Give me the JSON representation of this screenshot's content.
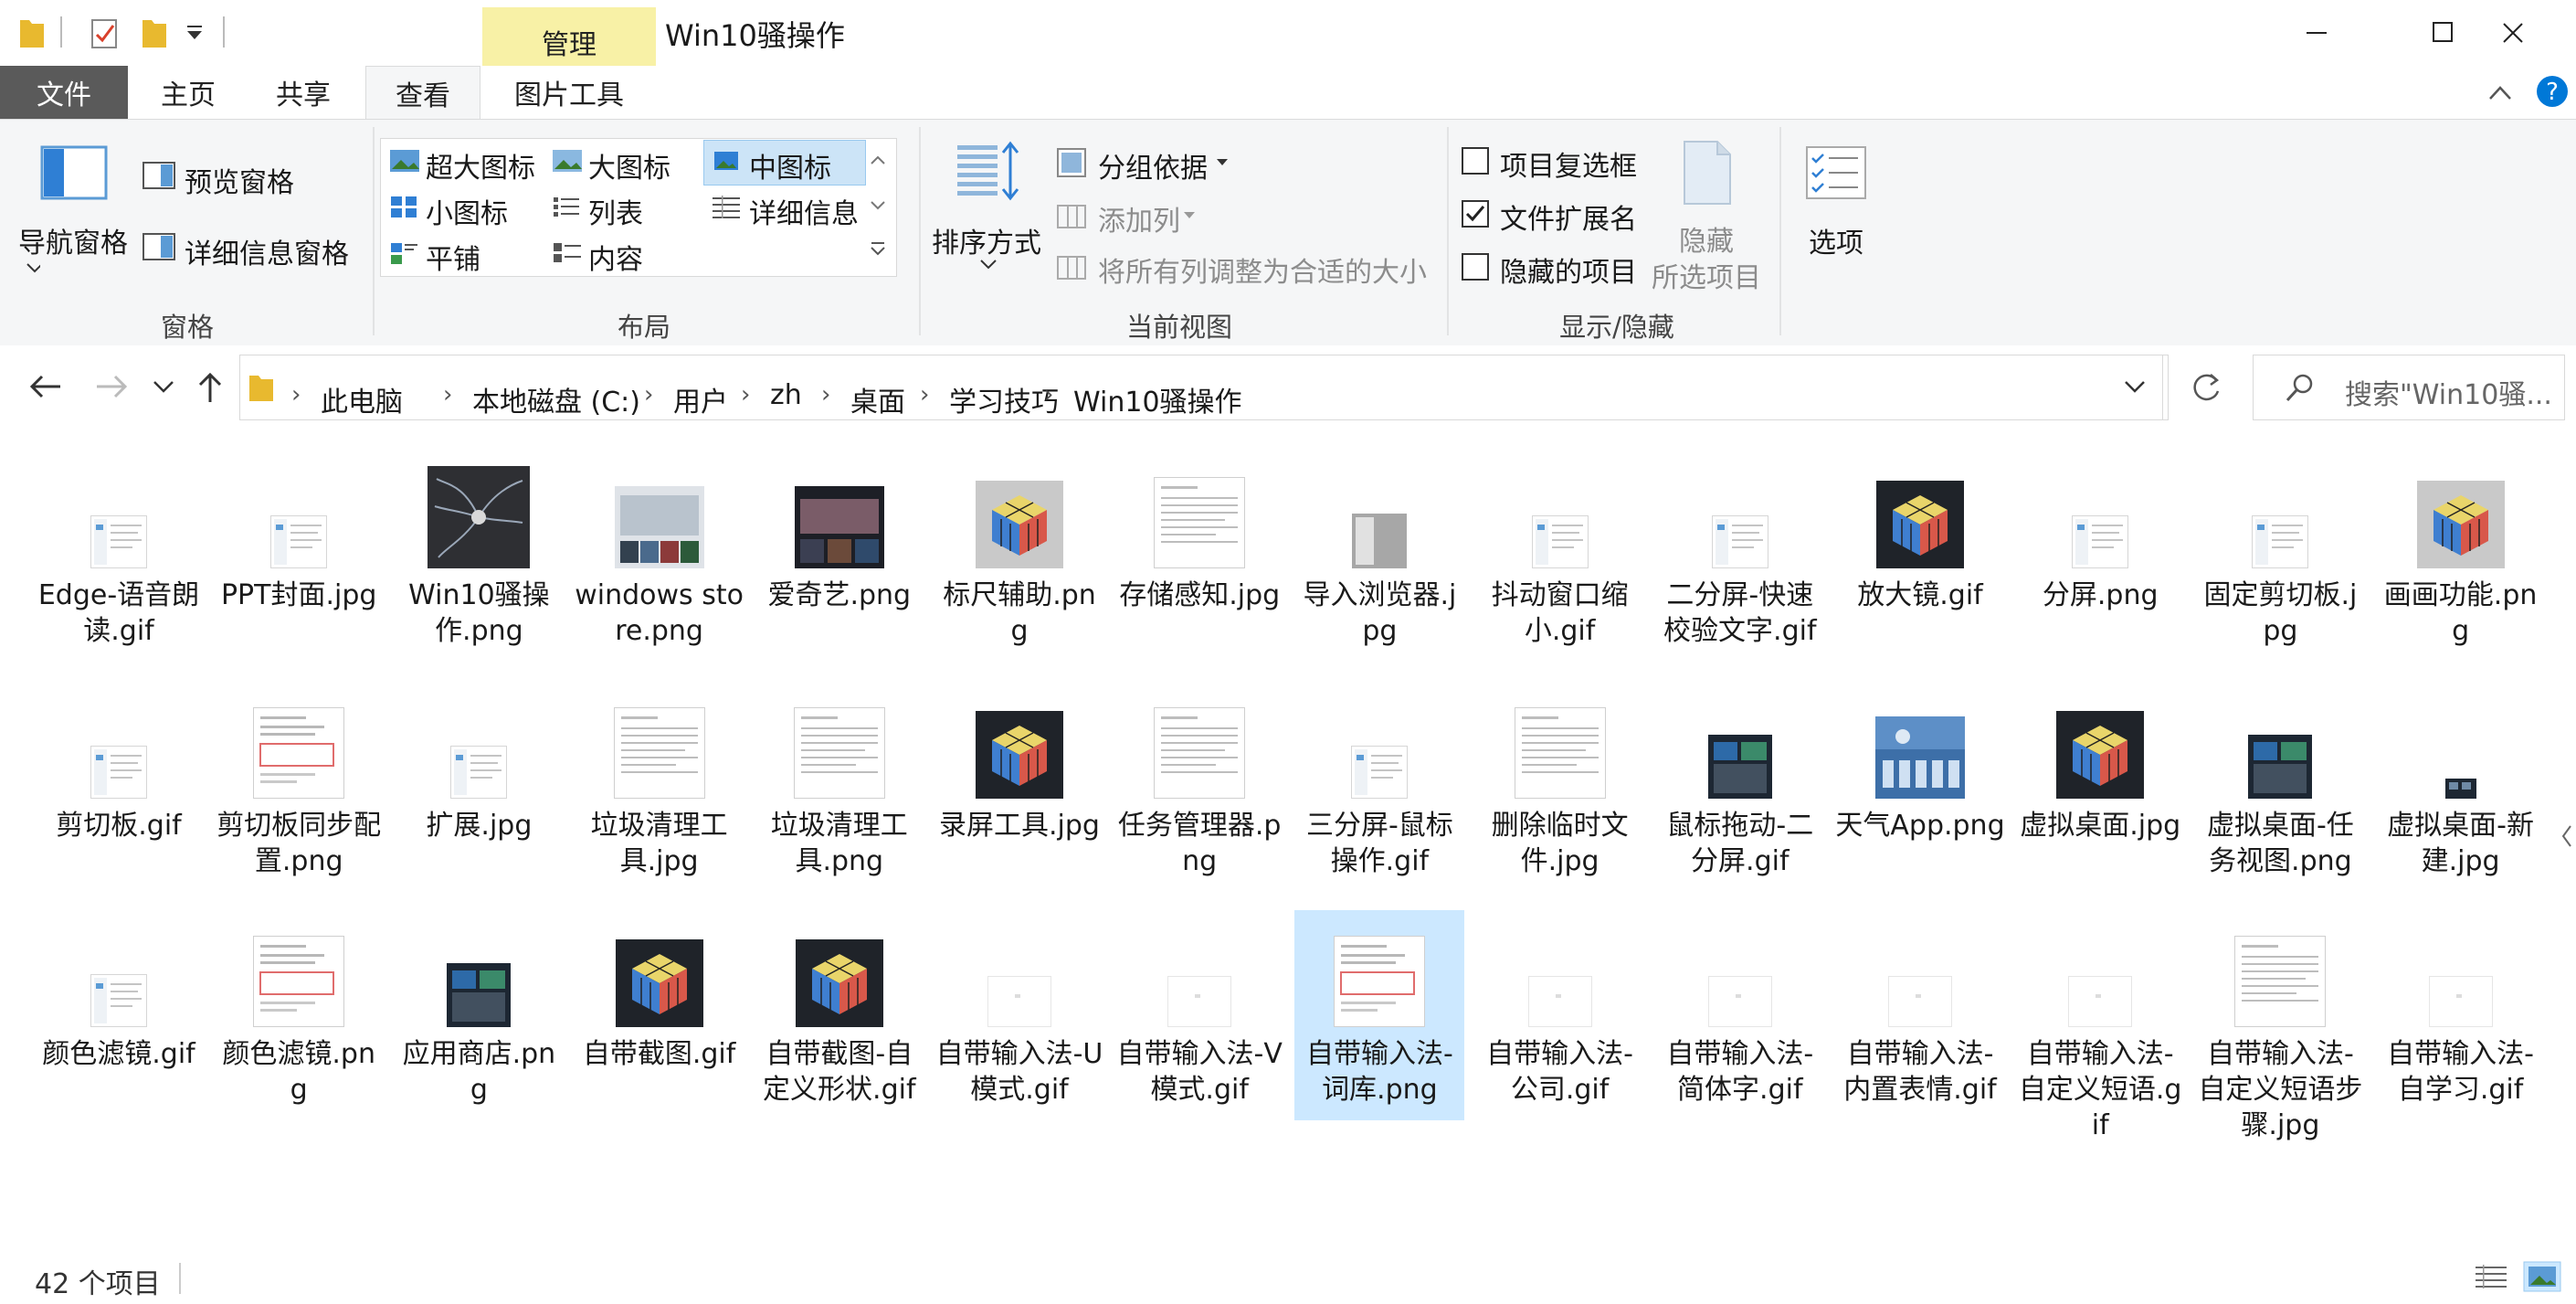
{
  "window": {
    "title": "Win10骚操作",
    "context_tab": "管理"
  },
  "ribbon_tabs": [
    "文件",
    "主页",
    "共享",
    "查看",
    "图片工具"
  ],
  "ribbon": {
    "panes": {
      "nav_pane": "导航窗格",
      "preview_pane": "预览窗格",
      "details_pane": "详细信息窗格",
      "group": "窗格"
    },
    "layout": {
      "options": [
        "超大图标",
        "大图标",
        "中图标",
        "小图标",
        "列表",
        "详细信息",
        "平铺",
        "内容"
      ],
      "selected": "中图标",
      "group": "布局"
    },
    "current_view": {
      "sort_by": "排序方式",
      "group_by": "分组依据",
      "add_columns": "添加列",
      "fit_columns": "将所有列调整为合适的大小",
      "group": "当前视图"
    },
    "show_hide": {
      "item_checkboxes": "项目复选框",
      "file_extensions": "文件扩展名",
      "hidden_items": "隐藏的项目",
      "hide_selected_line1": "隐藏",
      "hide_selected_line2": "所选项目",
      "group": "显示/隐藏",
      "checked": {
        "item_checkboxes": false,
        "file_extensions": true,
        "hidden_items": false
      }
    },
    "options": "选项"
  },
  "address": {
    "breadcrumbs": [
      "此电脑",
      "本地磁盘 (C:)",
      "用户",
      "zh",
      "桌面",
      "学习技巧",
      "Win10骚操作"
    ],
    "search_placeholder": "搜索\"Win10骚..."
  },
  "files": [
    {
      "name": "Edge-语音朗读.gif",
      "thumb": "doc-small"
    },
    {
      "name": "PPT封面.jpg",
      "thumb": "doc-small"
    },
    {
      "name": "Win10骚操作.png",
      "thumb": "mindmap"
    },
    {
      "name": "windows store.png",
      "thumb": "store"
    },
    {
      "name": "爱奇艺.png",
      "thumb": "video"
    },
    {
      "name": "标尺辅助.png",
      "thumb": "cube-gray"
    },
    {
      "name": "存储感知.jpg",
      "thumb": "doc"
    },
    {
      "name": "导入浏览器.jpg",
      "thumb": "gray"
    },
    {
      "name": "抖动窗口缩小.gif",
      "thumb": "doc-small"
    },
    {
      "name": "二分屏-快速校验文字.gif",
      "thumb": "doc-small"
    },
    {
      "name": "放大镜.gif",
      "thumb": "cube-dark"
    },
    {
      "name": "分屏.png",
      "thumb": "doc-small"
    },
    {
      "name": "固定剪切板.jpg",
      "thumb": "doc-small"
    },
    {
      "name": "画画功能.png",
      "thumb": "cube-gray"
    },
    {
      "name": "剪切板.gif",
      "thumb": "doc-small"
    },
    {
      "name": "剪切板同步配置.png",
      "thumb": "doc-red"
    },
    {
      "name": "扩展.jpg",
      "thumb": "doc-small"
    },
    {
      "name": "垃圾清理工具.jpg",
      "thumb": "doc"
    },
    {
      "name": "垃圾清理工具.png",
      "thumb": "doc"
    },
    {
      "name": "录屏工具.jpg",
      "thumb": "cube-dark"
    },
    {
      "name": "任务管理器.png",
      "thumb": "doc"
    },
    {
      "name": "三分屏-鼠标操作.gif",
      "thumb": "doc-small"
    },
    {
      "name": "删除临时文件.jpg",
      "thumb": "doc"
    },
    {
      "name": "鼠标拖动-二分屏.gif",
      "thumb": "dark-small"
    },
    {
      "name": "天气App.png",
      "thumb": "weather"
    },
    {
      "name": "虚拟桌面.jpg",
      "thumb": "cube-dark"
    },
    {
      "name": "虚拟桌面-任务视图.png",
      "thumb": "dark-small"
    },
    {
      "name": "虚拟桌面-新建.jpg",
      "thumb": "dark-tiny"
    },
    {
      "name": "颜色滤镜.gif",
      "thumb": "doc-small"
    },
    {
      "name": "颜色滤镜.png",
      "thumb": "doc-red"
    },
    {
      "name": "应用商店.png",
      "thumb": "dark-small"
    },
    {
      "name": "自带截图.gif",
      "thumb": "cube-dark"
    },
    {
      "name": "自带截图-自定义形状.gif",
      "thumb": "cube-dark"
    },
    {
      "name": "自带输入法-U模式.gif",
      "thumb": "blank"
    },
    {
      "name": "自带输入法-V模式.gif",
      "thumb": "blank"
    },
    {
      "name": "自带输入法-词库.png",
      "thumb": "doc-red",
      "selected": true
    },
    {
      "name": "自带输入法-公司.gif",
      "thumb": "blank"
    },
    {
      "name": "自带输入法-简体字.gif",
      "thumb": "blank"
    },
    {
      "name": "自带输入法-内置表情.gif",
      "thumb": "blank"
    },
    {
      "name": "自带输入法-自定义短语.gif",
      "thumb": "blank"
    },
    {
      "name": "自带输入法-自定义短语步骤.jpg",
      "thumb": "doc"
    },
    {
      "name": "自带输入法-自学习.gif",
      "thumb": "blank"
    }
  ],
  "status": {
    "item_count": "42 个项目"
  },
  "colors": {
    "accent": "#0078d7",
    "file_tab": "#5a5a5a",
    "context_tab": "#f8f1a6",
    "selection": "#cce8ff",
    "folder": "#e8b92f"
  }
}
